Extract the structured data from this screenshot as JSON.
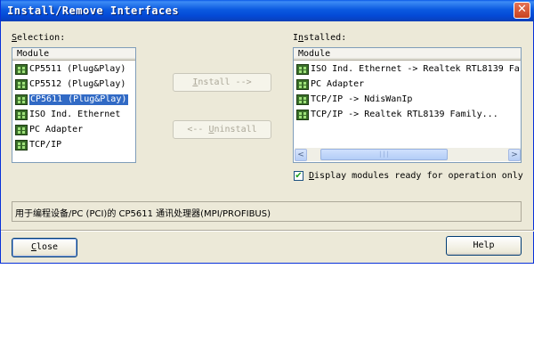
{
  "window": {
    "title": "Install/Remove Interfaces",
    "close_glyph": "✕"
  },
  "selection": {
    "label_accel": "S",
    "label_rest": "election:",
    "column_header": "Module",
    "items": [
      {
        "label": "CP5511 (Plug&Play)",
        "icon": "network-card-icon",
        "selected": false
      },
      {
        "label": "CP5512 (Plug&Play)",
        "icon": "network-card-icon",
        "selected": false
      },
      {
        "label": "CP5611 (Plug&Play)",
        "icon": "network-card-icon",
        "selected": true
      },
      {
        "label": "ISO Ind. Ethernet",
        "icon": "network-card-icon",
        "selected": false
      },
      {
        "label": "PC Adapter",
        "icon": "network-card-icon",
        "selected": false
      },
      {
        "label": "TCP/IP",
        "icon": "network-card-icon",
        "selected": false
      }
    ]
  },
  "installed": {
    "label_pre": "I",
    "label_accel": "n",
    "label_rest": "stalled:",
    "column_header": "Module",
    "items": [
      {
        "label": "ISO Ind. Ethernet -> Realtek RTL8139 Fa",
        "icon": "network-card-icon"
      },
      {
        "label": "PC Adapter",
        "icon": "network-card-icon"
      },
      {
        "label": "TCP/IP -> NdisWanIp",
        "icon": "network-card-icon"
      },
      {
        "label": "TCP/IP -> Realtek RTL8139 Family...",
        "icon": "network-card-icon"
      }
    ],
    "scroll_left": "<",
    "scroll_right": ">",
    "thumb_grip": "|||"
  },
  "buttons": {
    "install_accel": "I",
    "install_rest": "nstall -->",
    "uninstall_pre": "<-- ",
    "uninstall_accel": "U",
    "uninstall_rest": "ninstall",
    "close_accel": "C",
    "close_rest": "lose",
    "help": "Help"
  },
  "checkbox": {
    "checked": true,
    "mark": "✔",
    "label_accel": "D",
    "label_rest": "isplay modules ready for operation only"
  },
  "status_text": "用于编程设备/PC (PCI)的 CP5611 通讯处理器(MPI/PROFIBUS)"
}
